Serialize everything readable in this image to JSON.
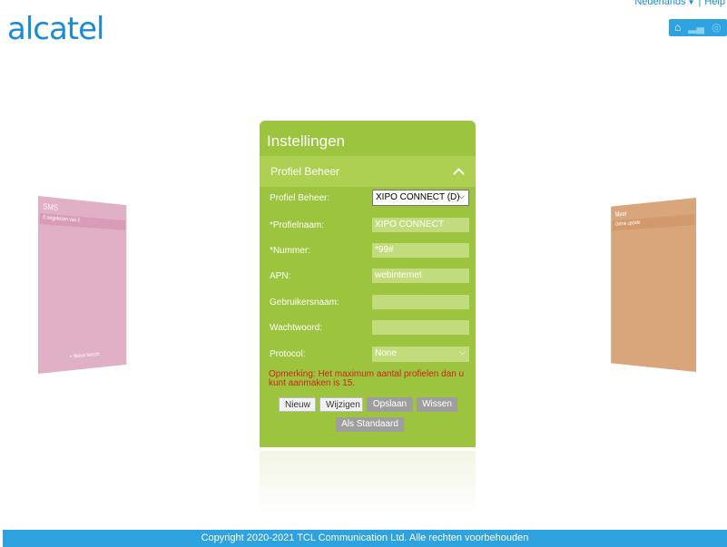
{
  "header": {
    "logo_text": "alcatel",
    "language": "Nederlands",
    "help_label": "Help",
    "status_icons": [
      "home-icon",
      "signal-icon",
      "globe-icon"
    ]
  },
  "left_tile": {
    "title": "SMS",
    "row_text": "0 ongelezen van 0",
    "add_label": "+ Nieuw bericht"
  },
  "right_tile": {
    "title": "Meer",
    "row_text": "Online update"
  },
  "card": {
    "title": "Instellingen",
    "section_title": "Profiel Beheer",
    "fields": [
      {
        "label": "Profiel Beheer:",
        "value": "XIPO CONNECT (D)"
      },
      {
        "label": "*Profielnaam:",
        "value": "XIPO CONNECT"
      },
      {
        "label": "*Nummer:",
        "value": "*99#"
      },
      {
        "label": "APN:",
        "value": "webinternet"
      },
      {
        "label": "Gebruikersnaam:",
        "value": ""
      },
      {
        "label": "Wachtwoord:",
        "value": ""
      },
      {
        "label": "Protocol:",
        "value": "None"
      }
    ],
    "note": "Opmerking: Het maximum aantal profielen dan u kunt aanmaken is 15.",
    "buttons": {
      "new": "Nieuw",
      "edit": "Wijzigen",
      "save": "Opslaan",
      "delete": "Wissen",
      "default": "Als Standaard"
    }
  },
  "footer": {
    "copyright": "Copyright 2020-2021 TCL Communication Ltd. Alle rechten voorbehouden"
  },
  "colors": {
    "brand_blue": "#1a8bd6",
    "card_green": "#9cc43e",
    "note_red": "#d2241b"
  }
}
